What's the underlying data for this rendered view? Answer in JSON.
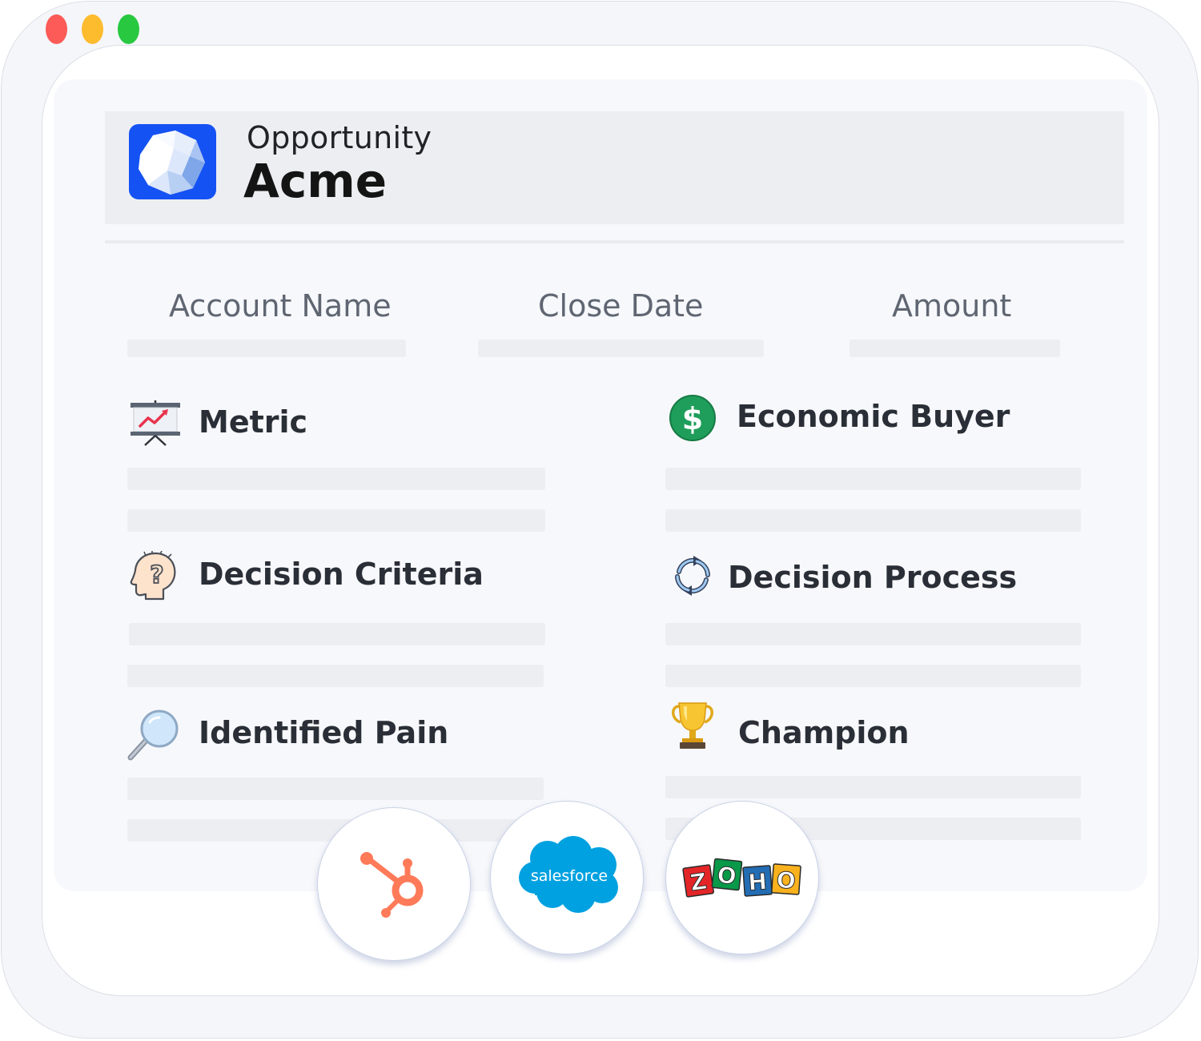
{
  "window": {
    "controls": [
      "close",
      "minimize",
      "maximize"
    ]
  },
  "header": {
    "label": "Opportunity",
    "name": "Acme",
    "logo_icon": "crystal-gem-logo"
  },
  "fields": [
    {
      "label": "Account Name"
    },
    {
      "label": "Close Date"
    },
    {
      "label": "Amount"
    }
  ],
  "sections": {
    "metric": {
      "title": "Metric",
      "icon": "presentation-chart-icon"
    },
    "economic_buyer": {
      "title": "Economic Buyer",
      "icon": "dollar-icon"
    },
    "decision_criteria": {
      "title": "Decision Criteria",
      "icon": "thinking-head-icon"
    },
    "decision_process": {
      "title": "Decision Process",
      "icon": "refresh-cycle-icon"
    },
    "identified_pain": {
      "title": "Identified Pain",
      "icon": "magnifier-icon"
    },
    "champion": {
      "title": "Champion",
      "icon": "trophy-icon"
    }
  },
  "integrations": {
    "hubspot": {
      "name": "HubSpot",
      "icon": "hubspot-logo"
    },
    "salesforce": {
      "name": "salesforce",
      "icon": "salesforce-logo"
    },
    "zoho": {
      "name": "ZOHO",
      "letters": [
        "Z",
        "O",
        "H",
        "O"
      ],
      "colors": [
        "#e42527",
        "#089949",
        "#226db4",
        "#f9b21d"
      ],
      "icon": "zoho-logo"
    }
  },
  "colors": {
    "accent": "#1552f3",
    "hubspot": "#ff7a59",
    "salesforce": "#00a1e0",
    "dollar": "#1e9e5a"
  }
}
